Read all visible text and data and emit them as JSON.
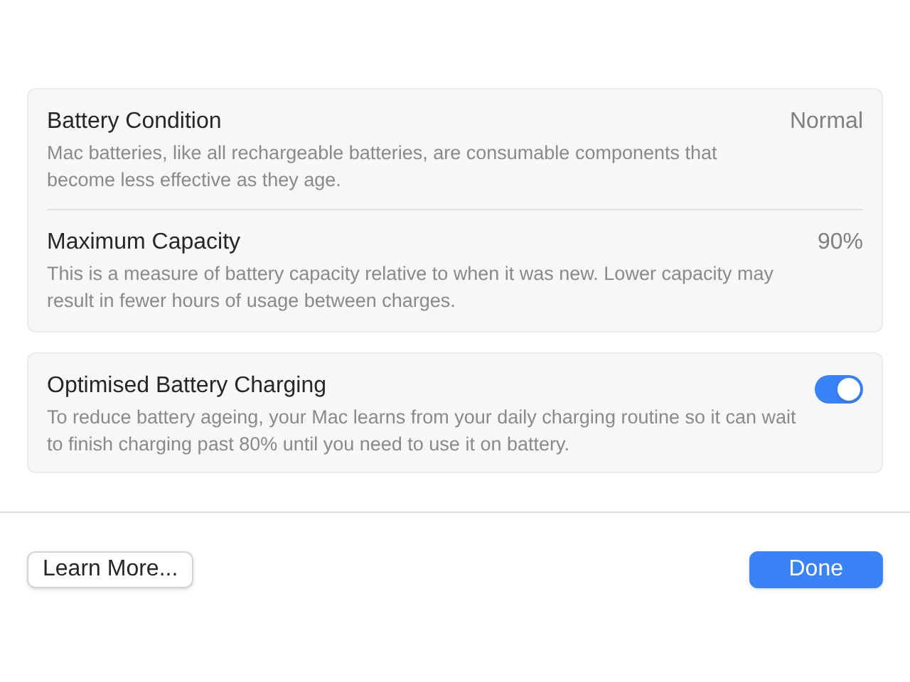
{
  "info_card": {
    "rows": [
      {
        "title": "Battery Condition",
        "description": "Mac batteries, like all rechargeable batteries, are consumable components that become less effective as they age.",
        "value": "Normal"
      },
      {
        "title": "Maximum Capacity",
        "description": "This is a measure of battery capacity relative to when it was new. Lower capacity may result in fewer hours of usage between charges.",
        "value": "90%"
      }
    ]
  },
  "charging_card": {
    "title": "Optimised Battery Charging",
    "description": "To reduce battery ageing, your Mac learns from your daily charging routine so it can wait to finish charging past 80% until you need to use it on battery.",
    "on": true
  },
  "buttons": [
    {
      "label": "Learn More...",
      "kind": "secondary"
    },
    {
      "label": "Done",
      "kind": "primary"
    }
  ]
}
